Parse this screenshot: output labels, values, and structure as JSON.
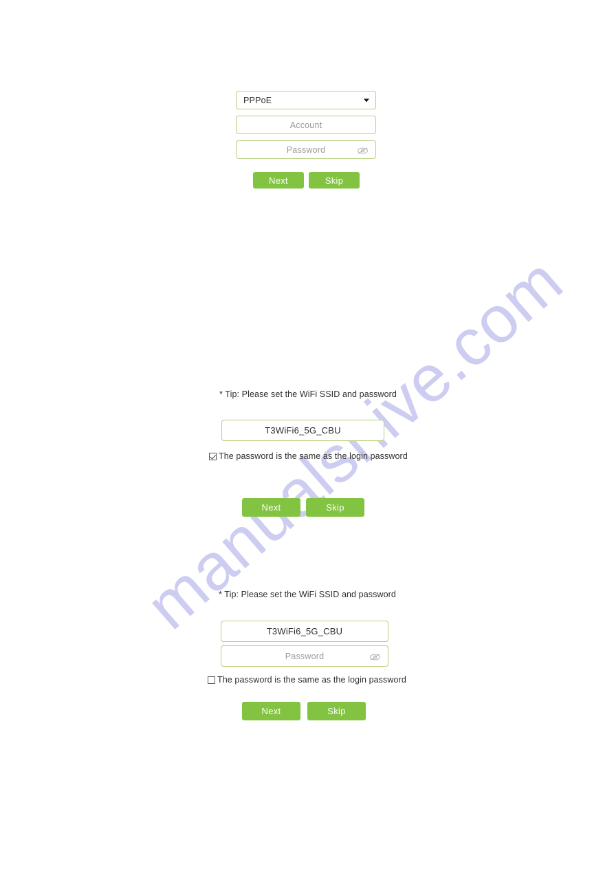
{
  "watermark": {
    "text": "manualshive.com",
    "color": "#cdcdf2"
  },
  "theme": {
    "accent_green": "#82c341",
    "field_border": "#b7cf7e",
    "placeholder_color": "#9a9a9a",
    "text_color": "#2e2e2e"
  },
  "wan_setup": {
    "connection_mode": "PPPoE",
    "mode_options": [
      "PPPoE"
    ],
    "account_placeholder": "Account",
    "account_value": "",
    "password_placeholder": "Password",
    "password_value": "",
    "toggle_password_icon": "eye-slash-icon",
    "dropdown_icon": "caret-down-icon",
    "next_label": "Next",
    "skip_label": "Skip"
  },
  "wifi_linked": {
    "tip": "* Tip: Please set the WiFi SSID and password",
    "ssid_value": "T3WiFi6_5G_CBU",
    "ssid_placeholder": "SSID",
    "same_password_label": "The password is the same as the login password",
    "same_password_checked": true,
    "next_label": "Next",
    "skip_label": "Skip"
  },
  "wifi_manual": {
    "tip": "* Tip: Please set the WiFi SSID and password",
    "ssid_value": "T3WiFi6_5G_CBU",
    "ssid_placeholder": "SSID",
    "password_placeholder": "Password",
    "password_value": "",
    "toggle_password_icon": "eye-slash-icon",
    "same_password_label": "The password is the same as the login password",
    "same_password_checked": false,
    "next_label": "Next",
    "skip_label": "Skip"
  }
}
